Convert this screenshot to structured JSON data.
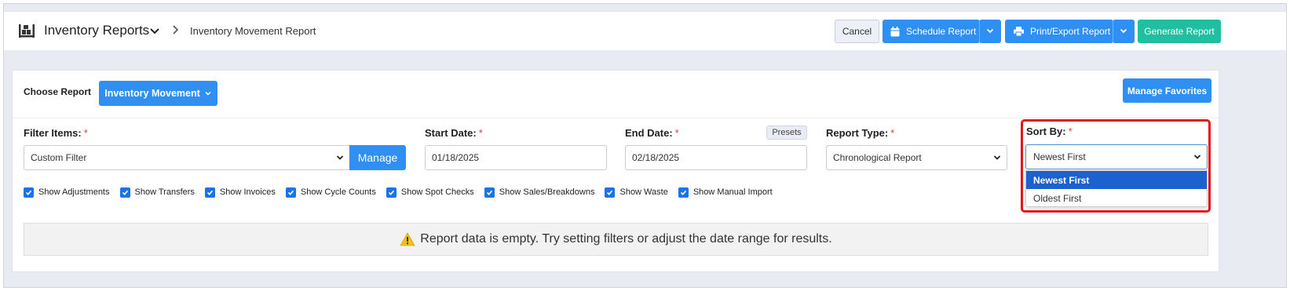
{
  "header": {
    "title": "Inventory Reports",
    "breadcrumb_current": "Inventory Movement Report",
    "cancel_label": "Cancel",
    "schedule_label": "Schedule Report",
    "print_label": "Print/Export Report",
    "generate_label": "Generate Report"
  },
  "report": {
    "choose_label": "Choose Report",
    "selected_report": "Inventory Movement",
    "manage_favorites_label": "Manage Favorites"
  },
  "filters": {
    "filter_items_label": "Filter Items:",
    "filter_items_value": "Custom Filter",
    "manage_label": "Manage",
    "start_date_label": "Start Date:",
    "start_date_value": "01/18/2025",
    "end_date_label": "End Date:",
    "end_date_value": "02/18/2025",
    "presets_label": "Presets",
    "report_type_label": "Report Type:",
    "report_type_value": "Chronological Report",
    "sort_by_label": "Sort By:",
    "sort_by_value": "Newest First",
    "sort_options": [
      "Newest First",
      "Oldest First"
    ],
    "required_marker": "*"
  },
  "checkboxes": [
    {
      "label": "Show Adjustments",
      "checked": true
    },
    {
      "label": "Show Transfers",
      "checked": true
    },
    {
      "label": "Show Invoices",
      "checked": true
    },
    {
      "label": "Show Cycle Counts",
      "checked": true
    },
    {
      "label": "Show Spot Checks",
      "checked": true
    },
    {
      "label": "Show Sales/Breakdowns",
      "checked": true
    },
    {
      "label": "Show Waste",
      "checked": true
    },
    {
      "label": "Show Manual Import",
      "checked": true
    }
  ],
  "empty_message": "Report data is empty. Try setting filters or adjust the date range for results.",
  "colors": {
    "primary": "#2f8ff2",
    "success": "#1fbf9f",
    "highlight": "#e8141b",
    "selected_option": "#1c62cf"
  }
}
